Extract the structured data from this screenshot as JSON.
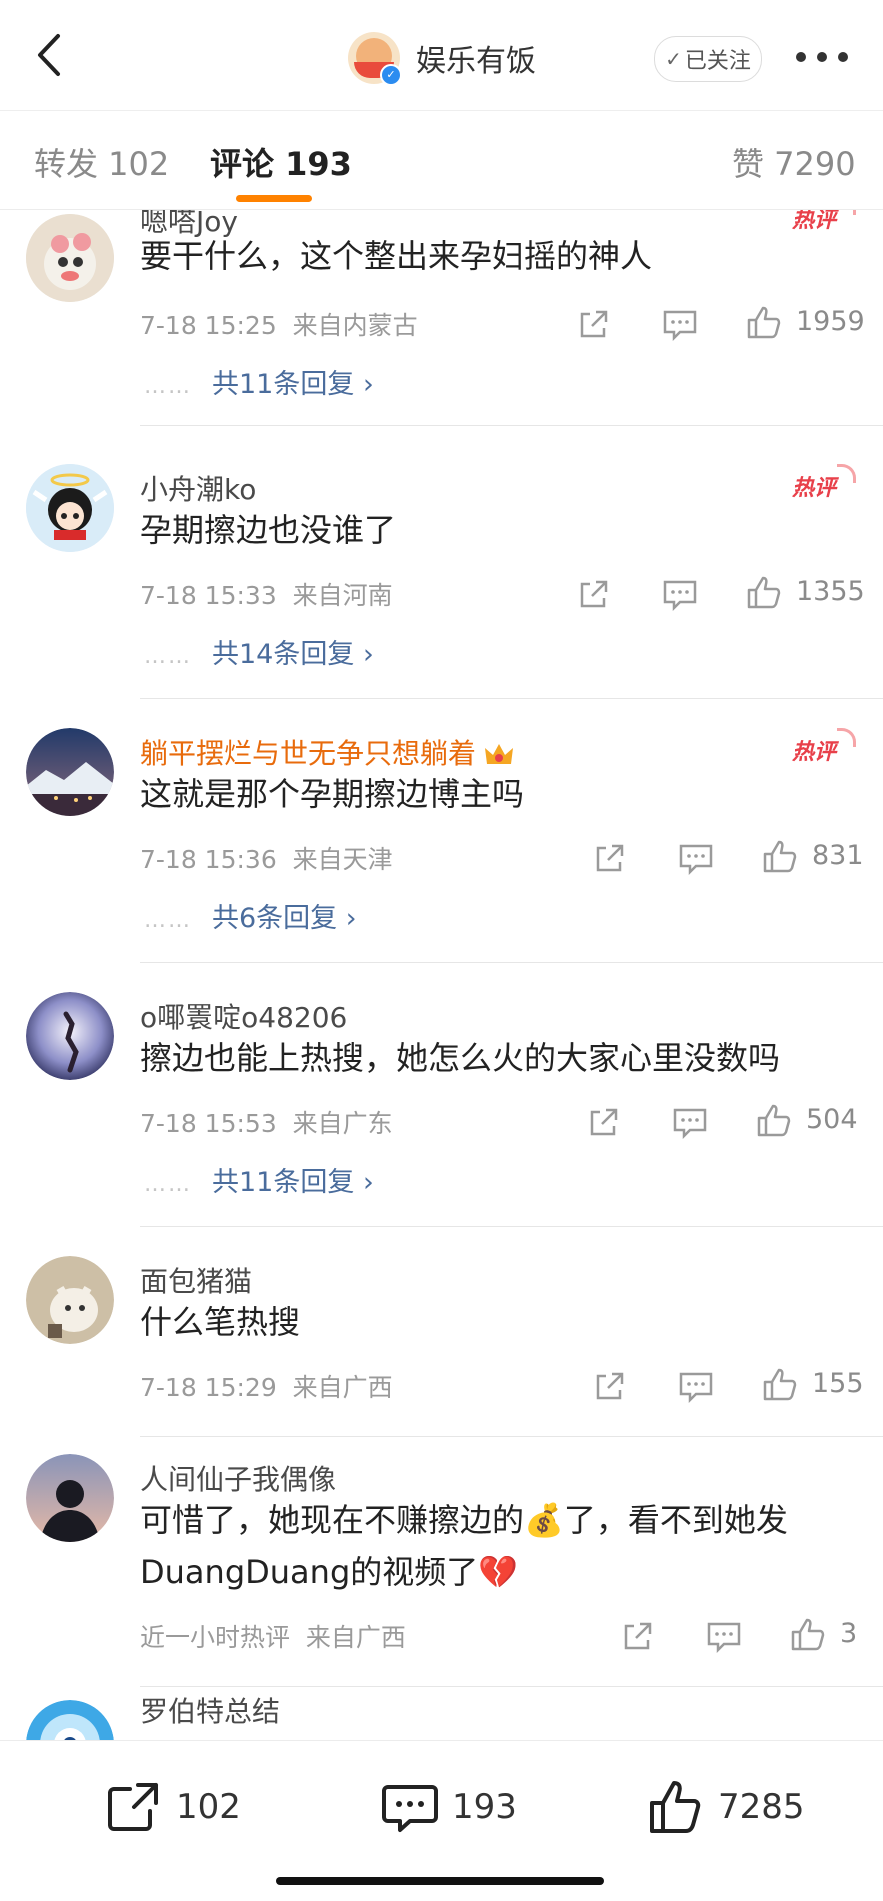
{
  "header": {
    "title": "娱乐有饭",
    "follow_label": "已关注",
    "follow_check": "✓"
  },
  "tabs": [
    {
      "label": "转发 102"
    },
    {
      "label": "评论 193"
    },
    {
      "label": "赞 7290"
    }
  ],
  "comments": [
    {
      "user": "嗯嗒Joy",
      "hot_label": "热评",
      "text": "要干什么，这个整出来孕妇摇的神人",
      "time": "7-18 15:25",
      "location": "来自内蒙古",
      "likes": "1959",
      "replies": "共11条回复 ›"
    },
    {
      "user": "小舟潮ko",
      "hot_label": "热评",
      "text": "孕期擦边也没谁了",
      "time": "7-18 15:33",
      "location": "来自河南",
      "likes": "1355",
      "replies": "共14条回复 ›"
    },
    {
      "user": "躺平摆烂与世无争只想躺着",
      "hot_label": "热评",
      "text": "这就是那个孕期擦边博主吗",
      "time": "7-18 15:36",
      "location": "来自天津",
      "likes": "831",
      "replies": "共6条回复 ›"
    },
    {
      "user": "o㖿瞏啶o48206",
      "text": "擦边也能上热搜，她怎么火的大家心里没数吗",
      "time": "7-18 15:53",
      "location": "来自广东",
      "likes": "504",
      "replies": "共11条回复 ›"
    },
    {
      "user": "面包猪猫",
      "text": "什么笔热搜",
      "time": "7-18 15:29",
      "location": "来自广西",
      "likes": "155"
    },
    {
      "user": "人间仙子我偶像",
      "text": "可惜了，她现在不赚擦边的💰了，看不到她发DuangDuang的视频了💔",
      "time": "近一小时热评",
      "location": "来自广西",
      "likes": "3"
    },
    {
      "user": "罗伯特总结"
    }
  ],
  "reply_dots": "……",
  "bottom": {
    "repost_count": "102",
    "comment_count": "193",
    "like_count": "7285"
  },
  "colors": {
    "accent": "#ff8200",
    "vip_name": "#e86b0c",
    "reply_link": "#4a6c9c",
    "hot_badge": "#e8404a"
  }
}
